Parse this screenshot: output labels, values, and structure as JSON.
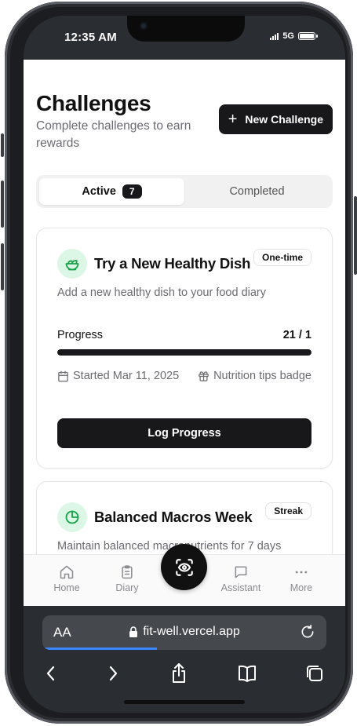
{
  "status_bar": {
    "time": "12:35 AM",
    "network": "5G"
  },
  "page": {
    "title": "Challenges",
    "subtitle": "Complete challenges to earn rewards",
    "new_button_label": "New Challenge"
  },
  "tabs": [
    {
      "label": "Active",
      "count": "7",
      "selected": true
    },
    {
      "label": "Completed",
      "selected": false
    }
  ],
  "challenges": [
    {
      "title": "Try a New Healthy Dish",
      "type": "One-time",
      "description": "Add a new healthy dish to your food diary",
      "progress_label": "Progress",
      "progress_value": "21 / 1",
      "progress_fraction": 1.0,
      "started": "Started Mar 11, 2025",
      "reward": "Nutrition tips badge",
      "action_label": "Log Progress",
      "icon": "salad-icon"
    },
    {
      "title": "Balanced Macros Week",
      "type": "Streak",
      "description": "Maintain balanced macronutrients for 7 days",
      "icon": "pie-chart-icon"
    }
  ],
  "bottom_nav": [
    {
      "label": "Home",
      "icon": "home-icon"
    },
    {
      "label": "Diary",
      "icon": "clipboard-icon"
    },
    {
      "label": "",
      "icon": "scan-icon"
    },
    {
      "label": "Assistant",
      "icon": "chat-icon"
    },
    {
      "label": "More",
      "icon": "more-icon"
    }
  ],
  "browser": {
    "aa_label": "AA",
    "url": "fit-well.vercel.app"
  },
  "colors": {
    "primary": "#18181b",
    "accent_green": "#16a34a",
    "icon_bg": "#dcf7e6",
    "muted_text": "#6b6b70",
    "link_blue": "#3a86ff"
  }
}
